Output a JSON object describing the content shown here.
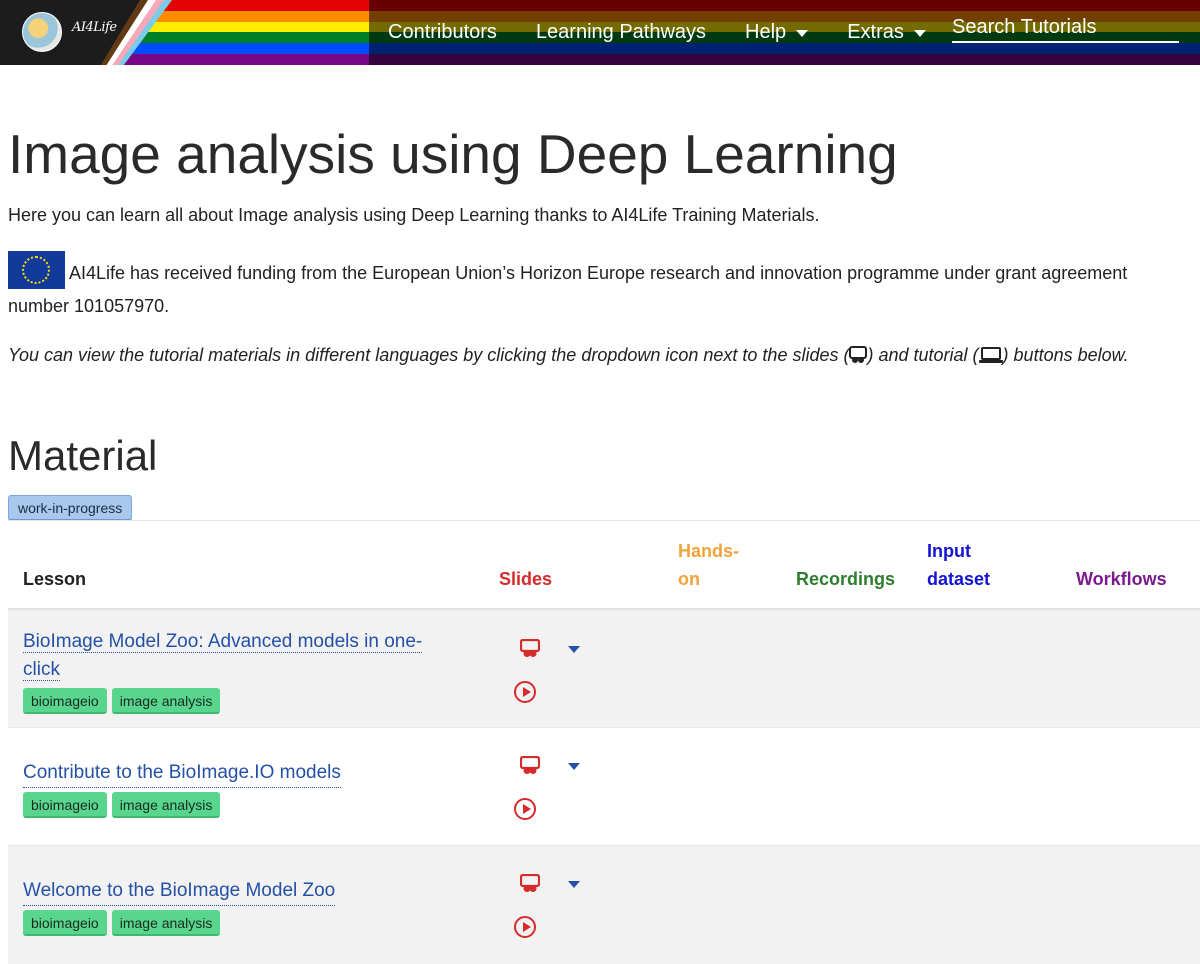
{
  "nav": {
    "brand": "AI4Life",
    "items": [
      "Contributors",
      "Learning Pathways",
      "Help",
      "Extras"
    ],
    "search_placeholder": "Search Tutorials",
    "stripe_colors": [
      "#e40303",
      "#ff8c00",
      "#ffed00",
      "#008026",
      "#004dff",
      "#750787"
    ]
  },
  "page": {
    "title": "Image analysis using Deep Learning",
    "intro": "Here you can learn all about Image analysis using Deep Learning thanks to AI4Life Training Materials.",
    "funding": "AI4Life has received funding from the European Union’s Horizon Europe research and innovation programme under grant agreement number 101057970.",
    "note_part1": "You can view the tutorial materials in different languages by clicking the dropdown icon next to the slides (",
    "note_part2": ") and tutorial (",
    "note_part3": ") buttons below.",
    "material_heading": "Material",
    "status_badge": "work-in-progress"
  },
  "table": {
    "headers": {
      "lesson": "Lesson",
      "slides": "Slides",
      "handson_1": "Hands-",
      "handson_2": "on",
      "recordings": "Recordings",
      "input_1": "Input",
      "input_2": "dataset",
      "workflows": "Workflows"
    },
    "header_colors": {
      "lesson": "#222222",
      "slides": "#d62b2b",
      "handson": "#f0a33a",
      "recordings": "#2f7d2f",
      "input": "#1414d6",
      "workflows": "#7a1a8c"
    },
    "rows": [
      {
        "title_line1": "BioImage Model Zoo: Advanced models in one-",
        "title_line2": "click",
        "tags": [
          "bioimageio",
          "image analysis"
        ]
      },
      {
        "title_line1": "Contribute to the BioImage.IO models",
        "title_line2": "",
        "tags": [
          "bioimageio",
          "image analysis"
        ]
      },
      {
        "title_line1": "Welcome to the BioImage Model Zoo",
        "title_line2": "",
        "tags": [
          "bioimageio",
          "image analysis"
        ]
      }
    ]
  }
}
